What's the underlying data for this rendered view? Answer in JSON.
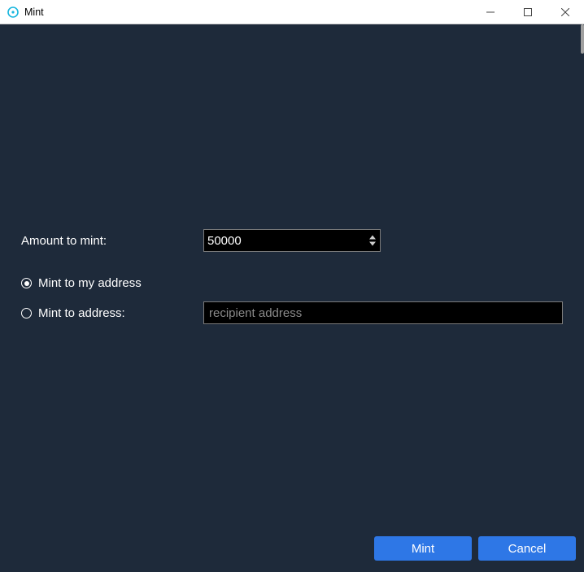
{
  "window": {
    "title": "Mint"
  },
  "form": {
    "amount_label": "Amount to mint:",
    "amount_value": "50000",
    "radio_my_address": "Mint to my address",
    "radio_to_address": "Mint to address:",
    "address_placeholder": "recipient address",
    "address_value": ""
  },
  "buttons": {
    "mint": "Mint",
    "cancel": "Cancel"
  },
  "colors": {
    "background": "#1e2a3a",
    "button": "#2e77e6",
    "input_bg": "#000000"
  }
}
